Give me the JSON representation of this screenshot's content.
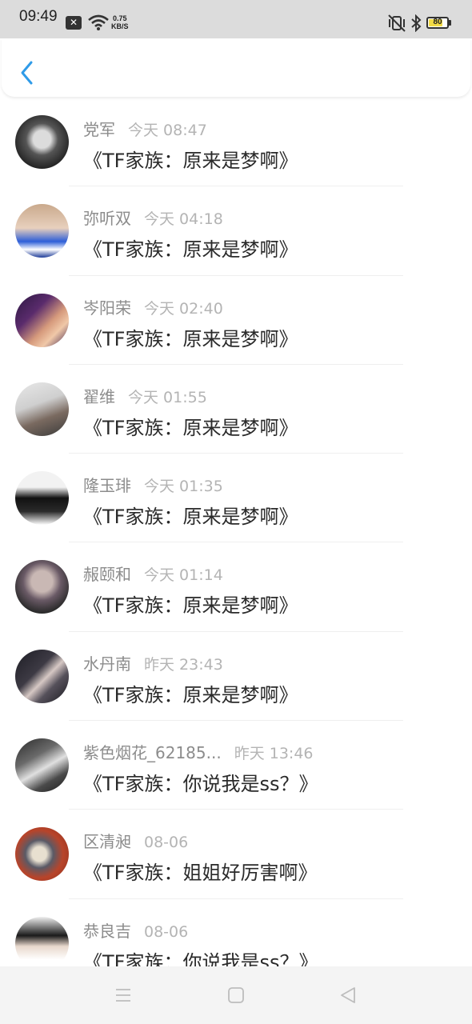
{
  "status_bar": {
    "time": "09:49",
    "speed_value": "0.75",
    "speed_unit": "KB/S",
    "battery_level": 80,
    "battery_label": "80",
    "battery_color": "#f3db45",
    "icons": [
      "notification-x-icon",
      "wifi-icon",
      "vibrate-mute-icon",
      "bluetooth-icon",
      "battery-icon"
    ]
  },
  "header": {
    "back_icon": "chevron-left-icon",
    "accent": "#2f9be8"
  },
  "items": [
    {
      "name": "党军",
      "time": "今天 08:47",
      "message": "《TF家族：原来是梦啊》"
    },
    {
      "name": "弥听双",
      "time": "今天 04:18",
      "message": "《TF家族：原来是梦啊》"
    },
    {
      "name": "岑阳荣",
      "time": "今天 02:40",
      "message": "《TF家族：原来是梦啊》"
    },
    {
      "name": "翟维",
      "time": "今天 01:55",
      "message": "《TF家族：原来是梦啊》"
    },
    {
      "name": "隆玉琲",
      "time": "今天 01:35",
      "message": "《TF家族：原来是梦啊》"
    },
    {
      "name": "赧颐和",
      "time": "今天 01:14",
      "message": "《TF家族：原来是梦啊》"
    },
    {
      "name": "水丹南",
      "time": "昨天 23:43",
      "message": "《TF家族：原来是梦啊》"
    },
    {
      "name": "紫色烟花_62185...",
      "time": "昨天 13:46",
      "message": "《TF家族：你说我是ss？》"
    },
    {
      "name": "区清昶",
      "time": "08-06",
      "message": "《TF家族：姐姐好厉害啊》"
    },
    {
      "name": "恭良吉",
      "time": "08-06",
      "message": "《TF家族：你说我是ss？》"
    }
  ],
  "nav_bar": {
    "icons": [
      "menu-icon",
      "home-icon",
      "back-triangle-icon"
    ]
  }
}
